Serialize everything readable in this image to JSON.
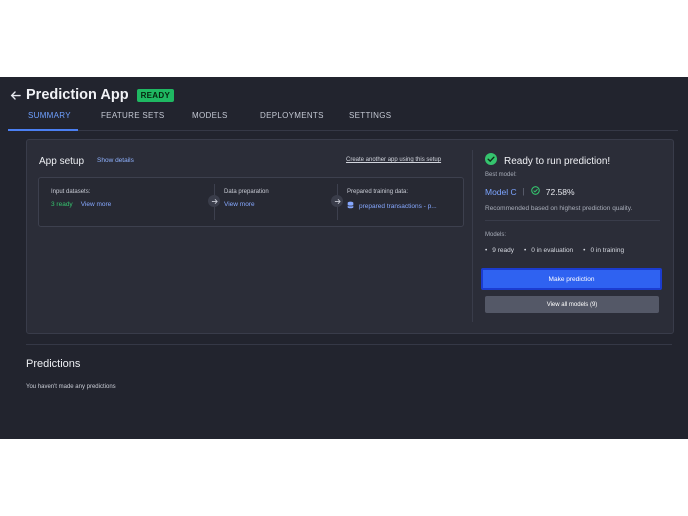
{
  "header": {
    "title": "Prediction App",
    "badge": "READY"
  },
  "tabs": [
    {
      "label": "SUMMARY",
      "active": true
    },
    {
      "label": "FEATURE SETS",
      "active": false
    },
    {
      "label": "MODELS",
      "active": false
    },
    {
      "label": "DEPLOYMENTS",
      "active": false
    },
    {
      "label": "SETTINGS",
      "active": false
    }
  ],
  "setup": {
    "title": "App setup",
    "show_details": "Show details",
    "create_link": "Create another app using this setup",
    "steps": [
      {
        "label": "Input datasets:",
        "value": "3 ready",
        "link": "View more"
      },
      {
        "label": "Data preparation",
        "link": "View more"
      },
      {
        "label": "Prepared training data:",
        "link": "prepared transactions - p..."
      }
    ]
  },
  "summary": {
    "ready_title": "Ready to run prediction!",
    "best_model_label": "Best model:",
    "best_model_name": "Model C",
    "accuracy": "72.58%",
    "recommendation": "Recommended based on highest prediction quality.",
    "models_label": "Models:",
    "stats": [
      "9 ready",
      "0 in evaluation",
      "0 in training"
    ],
    "primary_button": "Make prediction",
    "secondary_button": "View all models (9)"
  },
  "predictions": {
    "title": "Predictions",
    "empty_text": "You haven't made any predictions"
  },
  "colors": {
    "background": "#22242e",
    "card": "#2b2d38",
    "accent": "#2f62f1",
    "ready_green": "#1fb862",
    "link_blue": "#86a8ff"
  }
}
